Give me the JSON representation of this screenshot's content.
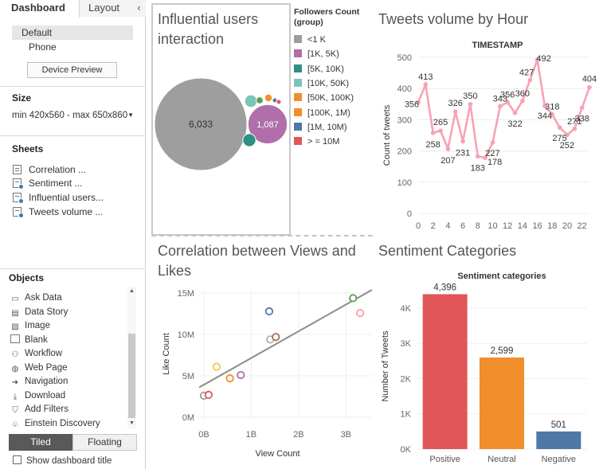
{
  "left_panel": {
    "tabs": {
      "dashboard": "Dashboard",
      "layout": "Layout",
      "collapse": "‹"
    },
    "devices": {
      "default": "Default",
      "phone": "Phone"
    },
    "device_preview": "Device Preview",
    "size": {
      "heading": "Size",
      "value": "min 420x560 - max 650x860"
    },
    "sheets": {
      "heading": "Sheets",
      "items": [
        "Correlation ...",
        "Sentiment ...",
        "Influential users...",
        "Tweets volume ..."
      ]
    },
    "objects": {
      "heading": "Objects",
      "items": [
        "Ask Data",
        "Data Story",
        "Image",
        "Blank",
        "Workflow",
        "Web Page",
        "Navigation",
        "Download",
        "Add Filters",
        "Einstein Discovery"
      ]
    },
    "tiled": "Tiled",
    "floating": "Floating",
    "show_title": "Show dashboard title"
  },
  "dashboard": {
    "influential": {
      "title_lines": [
        "Influential users",
        "interaction"
      ],
      "legend_title_lines": [
        "Followers Count",
        "(group)"
      ],
      "legend": [
        {
          "label": "<1 K",
          "color": "#9e9e9e"
        },
        {
          "label": "[1K, 5K)",
          "color": "#b06fa8"
        },
        {
          "label": "[5K, 10K)",
          "color": "#2f8f84"
        },
        {
          "label": "[10K, 50K)",
          "color": "#79c5b8"
        },
        {
          "label": "[50K, 100K)",
          "color": "#f28e2b"
        },
        {
          "label": "[100K, 1M)",
          "color": "#f28e2b"
        },
        {
          "label": "[1M, 10M)",
          "color": "#4e79a7"
        },
        {
          "label": "> = 10M",
          "color": "#e15759"
        }
      ],
      "bubble_labels": [
        "6,033",
        "1,087"
      ]
    },
    "correlation_title_lines": [
      "Correlation between Views and",
      "Likes"
    ],
    "sentiment_title": "Sentiment Categories",
    "tweets_title": "Tweets volume by Hour"
  },
  "chart_data": [
    {
      "type": "scatter",
      "name": "bubble",
      "note_values_shown": [
        6033,
        1087
      ],
      "categories": [
        "<1 K",
        "[1K, 5K)",
        "[5K, 10K)",
        "[10K, 50K)",
        "[50K, 100K)",
        "[100K, 1M)",
        "[1M, 10M)",
        "> = 10M"
      ],
      "values": [
        6033,
        1087,
        110,
        120,
        40,
        35,
        15,
        10
      ]
    },
    {
      "type": "line",
      "title": "TIMESTAMP",
      "ylabel": "Count of tweets",
      "x": [
        0,
        1,
        2,
        3,
        4,
        5,
        6,
        7,
        8,
        9,
        10,
        11,
        12,
        13,
        14,
        15,
        16,
        17,
        18,
        19,
        20,
        21,
        22,
        23
      ],
      "values": [
        356,
        413,
        258,
        265,
        207,
        326,
        231,
        350,
        183,
        178,
        227,
        343,
        356,
        322,
        360,
        427,
        492,
        344,
        318,
        275,
        252,
        271,
        338,
        404
      ],
      "ylim": [
        0,
        500
      ],
      "yticks": [
        0,
        100,
        200,
        300,
        400,
        500
      ],
      "xticks": [
        0,
        2,
        4,
        6,
        8,
        10,
        12,
        14,
        16,
        18,
        20,
        22
      ],
      "color": "#f7a3b4"
    },
    {
      "type": "scatter",
      "xlabel": "View Count",
      "ylabel": "Like Count",
      "xticks": [
        "0B",
        "1B",
        "2B",
        "3B"
      ],
      "yticks": [
        "0M",
        "5M",
        "10M",
        "15M"
      ],
      "xlim": [
        -0.1,
        3.55
      ],
      "ylim": [
        -0.2,
        15.5
      ],
      "points": [
        {
          "x": 0.0,
          "y": 2.6,
          "color": "#9e9e9e"
        },
        {
          "x": 0.1,
          "y": 2.7,
          "color": "#e15759"
        },
        {
          "x": 0.27,
          "y": 6.1,
          "color": "#edc948"
        },
        {
          "x": 0.55,
          "y": 4.7,
          "color": "#f28e2b"
        },
        {
          "x": 0.78,
          "y": 5.1,
          "color": "#b06fa8"
        },
        {
          "x": 1.4,
          "y": 9.4,
          "color": "#bab0ac"
        },
        {
          "x": 1.52,
          "y": 9.7,
          "color": "#9c755f"
        },
        {
          "x": 1.38,
          "y": 12.8,
          "color": "#4e79a7"
        },
        {
          "x": 3.15,
          "y": 14.4,
          "color": "#59a14f"
        },
        {
          "x": 3.3,
          "y": 12.6,
          "color": "#ff9da7"
        }
      ],
      "trend": [
        [
          -0.1,
          3.6
        ],
        [
          3.55,
          15.4
        ]
      ]
    },
    {
      "type": "bar",
      "title": "Sentiment categories",
      "ylabel": "Number of Tweets",
      "categories": [
        "Positive",
        "Neutral",
        "Negative"
      ],
      "values": [
        4396,
        2599,
        501
      ],
      "value_labels": [
        "4,396",
        "2,599",
        "501"
      ],
      "colors": [
        "#e15759",
        "#f28e2b",
        "#4e79a7"
      ],
      "yticks": [
        "0K",
        "1K",
        "2K",
        "3K",
        "4K"
      ],
      "ylim": [
        0,
        4700
      ]
    }
  ]
}
